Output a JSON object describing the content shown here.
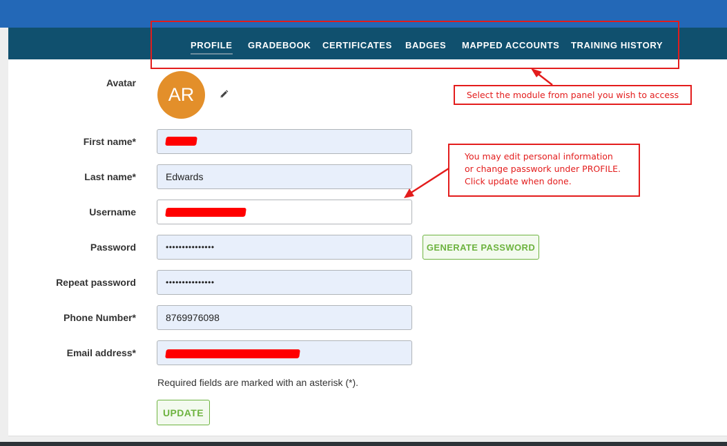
{
  "nav": {
    "tabs": [
      {
        "label": "PROFILE",
        "active": true
      },
      {
        "label": "GRADEBOOK"
      },
      {
        "label": "CERTIFICATES"
      },
      {
        "label": "BADGES"
      },
      {
        "label": "MAPPED ACCOUNTS"
      },
      {
        "label": "TRAINING HISTORY"
      }
    ]
  },
  "profile": {
    "avatar_label": "Avatar",
    "avatar_initials": "AR",
    "avatar_color": "#e38f2a",
    "edit_icon": "pencil-icon",
    "fields": {
      "first_name": {
        "label": "First name*",
        "value": ""
      },
      "last_name": {
        "label": "Last name*",
        "value": "Edwards"
      },
      "username": {
        "label": "Username",
        "value": ""
      },
      "password": {
        "label": "Password",
        "value": "•••••••••••••••"
      },
      "repeat_password": {
        "label": "Repeat password",
        "value": "•••••••••••••••"
      },
      "phone": {
        "label": "Phone Number*",
        "value": "8769976098"
      },
      "email": {
        "label": "Email address*",
        "value": ""
      }
    },
    "generate_password_label": "GENERATE PASSWORD",
    "required_note": "Required fields are marked with an asterisk (*).",
    "update_label": "UPDATE"
  },
  "annotations": {
    "nav_callout": "Select the module from panel you wish to access",
    "form_callout": {
      "line1": "You may edit personal information",
      "line2": "or change passwork under PROFILE.",
      "line3": "Click update when done."
    },
    "color": "#e31c1c"
  },
  "colors": {
    "topbar": "#2368b7",
    "navbar": "#10506e",
    "accent_green": "#6db33f",
    "input_fill": "#e8effb"
  }
}
